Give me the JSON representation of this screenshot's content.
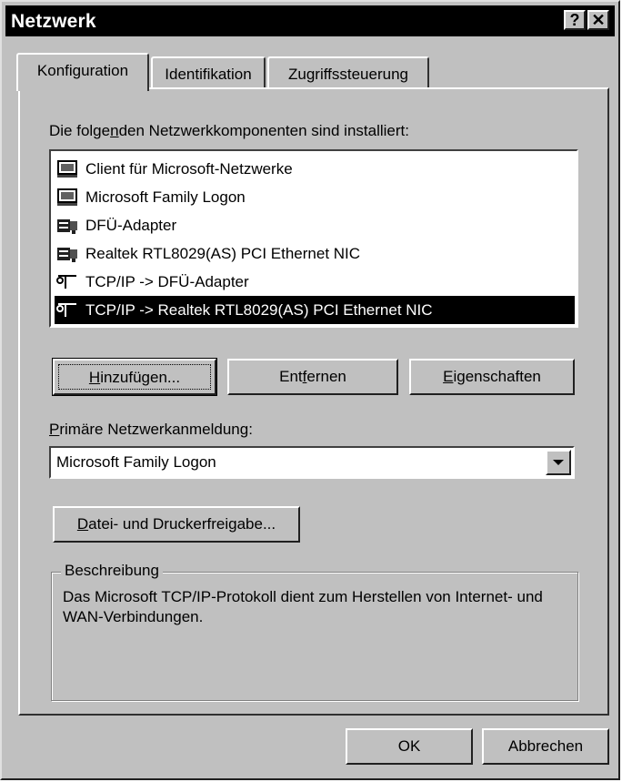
{
  "window": {
    "title": "Netzwerk",
    "help_label": "?",
    "close_label": "✕"
  },
  "tabs": [
    {
      "label": "Konfiguration",
      "active": true
    },
    {
      "label": "Identifikation",
      "active": false
    },
    {
      "label": "Zugriffssteuerung",
      "active": false
    }
  ],
  "components": {
    "heading_before": "Die folge",
    "heading_underlined": "n",
    "heading_after": "den Netzwerkkomponenten sind installiert:",
    "items": [
      {
        "label": "Client für Microsoft-Netzwerke",
        "icon": "client-icon"
      },
      {
        "label": "Microsoft Family Logon",
        "icon": "client-icon"
      },
      {
        "label": "DFÜ-Adapter",
        "icon": "adapter-icon"
      },
      {
        "label": "Realtek RTL8029(AS) PCI Ethernet NIC",
        "icon": "adapter-icon"
      },
      {
        "label": "TCP/IP -> DFÜ-Adapter",
        "icon": "protocol-icon"
      },
      {
        "label": "TCP/IP -> Realtek RTL8029(AS) PCI Ethernet NIC",
        "icon": "protocol-icon",
        "selected": true
      }
    ]
  },
  "buttons": {
    "add_u": "H",
    "add_rest": "inzufügen...",
    "remove_pre": "Ent",
    "remove_u": "f",
    "remove_post": "ernen",
    "props_u": "E",
    "props_rest": "igenschaften",
    "share_u": "D",
    "share_rest": "atei- und Druckerfreigabe...",
    "ok": "OK",
    "cancel": "Abbrechen"
  },
  "primary_logon": {
    "label_u": "P",
    "label_rest": "rimäre Netzwerkanmeldung:",
    "value": "Microsoft Family Logon"
  },
  "description": {
    "title": "Beschreibung",
    "text": "Das Microsoft TCP/IP-Protokoll dient zum Herstellen von Internet- und WAN-Verbindungen."
  },
  "colors": {
    "face": "#c0c0c0",
    "titlebar": "#000000",
    "selection": "#000000"
  }
}
